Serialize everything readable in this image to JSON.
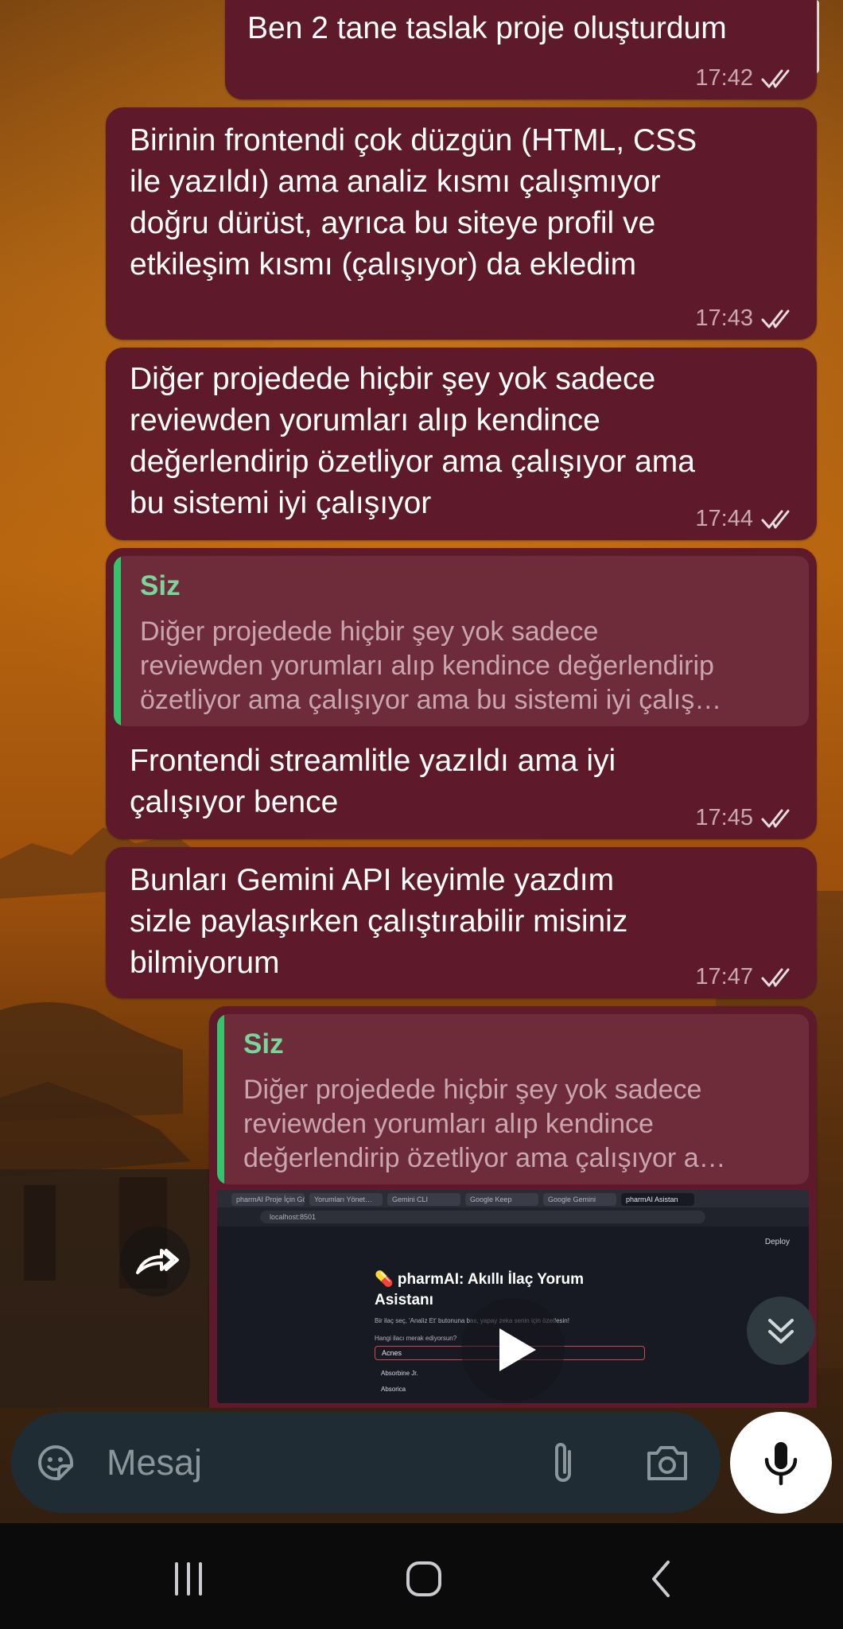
{
  "messages": [
    {
      "text": "Ben 2 tane taslak proje oluşturdum",
      "time": "17:42"
    },
    {
      "text": "Birinin frontendi çok düzgün (HTML, CSS\nile yazıldı) ama analiz kısmı çalışmıyor\ndoğru dürüst, ayrıca bu siteye profil ve\netkileşim kısmı (çalışıyor) da ekledim",
      "time": "17:43"
    },
    {
      "text": "Diğer projedede hiçbir şey yok sadece\nreviewden yorumları alıp kendince\ndeğerlendirip özetliyor ama çalışıyor ama\nbu sistemi iyi çalışıyor",
      "time": "17:44"
    },
    {
      "quote": {
        "author": "Siz",
        "text": "Diğer projedede hiçbir şey yok sadece\nreviewden yorumları alıp kendince değerlendirip\nözetliyor ama çalışıyor ama bu sistemi iyi çalış…"
      },
      "text": "Frontendi streamlitle yazıldı ama iyi\nçalışıyor bence",
      "time": "17:45"
    },
    {
      "text": "Bunları Gemini API keyimle yazdım\nsizle paylaşırken çalıştırabilir misiniz\nbilmiyorum",
      "time": "17:47"
    },
    {
      "quote": {
        "author": "Siz",
        "text": "Diğer projedede hiçbir şey yok sadece\nreviewden yorumları alıp kendince\ndeğerlendirip özetliyor ama çalışıyor a…"
      },
      "video": {
        "tabs": [
          "pharmAI Proje İçin Gör…",
          "Yorumları Yönet…",
          "Gemini CLI",
          "Google Keep",
          "Google Gemini",
          "pharmAI Asistan"
        ],
        "address": "localhost:8501",
        "deploy": "Deploy",
        "title": "💊 pharmAI: Akıllı İlaç Yorum\nAsistanı",
        "subtitle": "Bir ilaç seç, 'Analiz Et' butonuna bas, yapay zeka senin için özetlesin!",
        "label": "Hangi ilacı merak ediyorsun?",
        "selected": "Acnes",
        "options": [
          "Absorbine Jr.",
          "Absorica"
        ]
      }
    }
  ],
  "composer": {
    "placeholder": "Mesaj"
  },
  "colors": {
    "bubble": "#5e1a2a",
    "quote_bar": "#35c46b",
    "quote_name": "#79d59a",
    "input_bar": "#1f2c33"
  }
}
